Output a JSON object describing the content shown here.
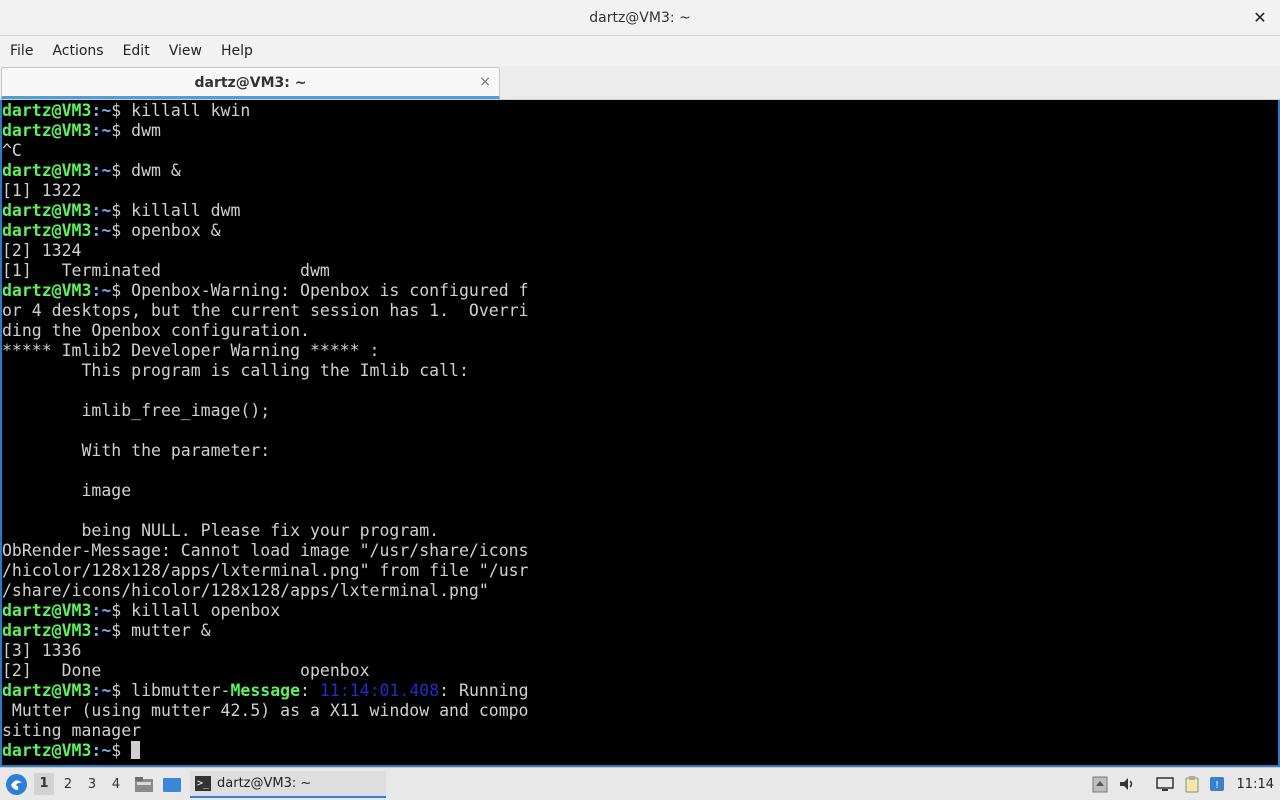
{
  "window": {
    "title": "dartz@VM3: ~",
    "close_glyph": "✕"
  },
  "menubar": {
    "items": [
      "File",
      "Actions",
      "Edit",
      "View",
      "Help"
    ]
  },
  "tab": {
    "label": "dartz@VM3: ~",
    "close_glyph": "×"
  },
  "terminal": {
    "prompt_user": "dartz@VM3",
    "prompt_path": ":~",
    "prompt_symbol": "$ ",
    "lines": [
      {
        "type": "cmd",
        "text": "killall kwin"
      },
      {
        "type": "cmd",
        "text": "dwm"
      },
      {
        "type": "out",
        "text": "^C"
      },
      {
        "type": "cmd",
        "text": "dwm &"
      },
      {
        "type": "out",
        "text": "[1] 1322"
      },
      {
        "type": "cmd",
        "text": "killall dwm"
      },
      {
        "type": "cmd",
        "text": "openbox &"
      },
      {
        "type": "out",
        "text": "[2] 1324"
      },
      {
        "type": "out",
        "text": "[1]   Terminated              dwm"
      },
      {
        "type": "cmd",
        "text": "Openbox-Warning: Openbox is configured f"
      },
      {
        "type": "out",
        "text": "or 4 desktops, but the current session has 1.  Overri"
      },
      {
        "type": "out",
        "text": "ding the Openbox configuration."
      },
      {
        "type": "out",
        "text": "***** Imlib2 Developer Warning ***** :"
      },
      {
        "type": "out",
        "text": "        This program is calling the Imlib call:"
      },
      {
        "type": "out",
        "text": ""
      },
      {
        "type": "out",
        "text": "        imlib_free_image();"
      },
      {
        "type": "out",
        "text": ""
      },
      {
        "type": "out",
        "text": "        With the parameter:"
      },
      {
        "type": "out",
        "text": ""
      },
      {
        "type": "out",
        "text": "        image"
      },
      {
        "type": "out",
        "text": ""
      },
      {
        "type": "out",
        "text": "        being NULL. Please fix your program."
      },
      {
        "type": "out",
        "text": "ObRender-Message: Cannot load image \"/usr/share/icons"
      },
      {
        "type": "out",
        "text": "/hicolor/128x128/apps/lxterminal.png\" from file \"/usr"
      },
      {
        "type": "out",
        "text": "/share/icons/hicolor/128x128/apps/lxterminal.png\""
      },
      {
        "type": "cmd",
        "text": "killall openbox"
      },
      {
        "type": "cmd",
        "text": "mutter &"
      },
      {
        "type": "out",
        "text": "[3] 1336"
      },
      {
        "type": "out",
        "text": "[2]   Done                    openbox"
      },
      {
        "type": "mutter",
        "pre": "libmutter-",
        "label": "Message",
        "colon": ": ",
        "time": "11:14:01.408",
        "rest": ": Running"
      },
      {
        "type": "out",
        "text": " Mutter (using mutter 42.5) as a X11 window and compo"
      },
      {
        "type": "out",
        "text": "siting manager"
      },
      {
        "type": "cursor",
        "text": ""
      }
    ]
  },
  "taskbar": {
    "workspaces": [
      "1",
      "2",
      "3",
      "4"
    ],
    "active_workspace": "1",
    "task_label": "dartz@VM3: ~",
    "task_icon_glyph": ">_",
    "clock": "11:14"
  },
  "icons": {
    "menu": "lxqt-menu-icon",
    "file_manager": "file-manager-icon",
    "show_desktop": "desktop-icon",
    "tray": [
      "notification-icon",
      "volume-icon",
      "network-icon",
      "clipboard-icon",
      "updates-icon"
    ]
  },
  "colors": {
    "prompt_user": "#5ef05e",
    "prompt_path": "#6fb1ff",
    "timestamp": "#1d2fc7",
    "terminal_bg": "#000000",
    "accent": "#2f78c4"
  }
}
